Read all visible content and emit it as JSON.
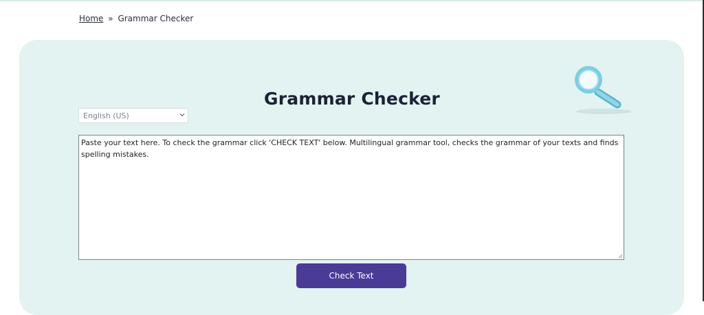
{
  "breadcrumb": {
    "home": "Home",
    "separator": "»",
    "current": "Grammar Checker"
  },
  "page": {
    "title": "Grammar Checker",
    "illustration_icon": "magnifier-icon"
  },
  "language_select": {
    "value": "English (US)",
    "icon": "chevron-down-icon"
  },
  "editor": {
    "text": "Paste your text here. To check the grammar click 'CHECK TEXT' below. Multilingual grammar tool, checks the grammar of your texts and finds spelling mistakes."
  },
  "actions": {
    "check_label": "Check Text"
  },
  "colors": {
    "panel_bg": "#e2f3f1",
    "button_bg": "#4a3b97",
    "title": "#1b2235"
  }
}
